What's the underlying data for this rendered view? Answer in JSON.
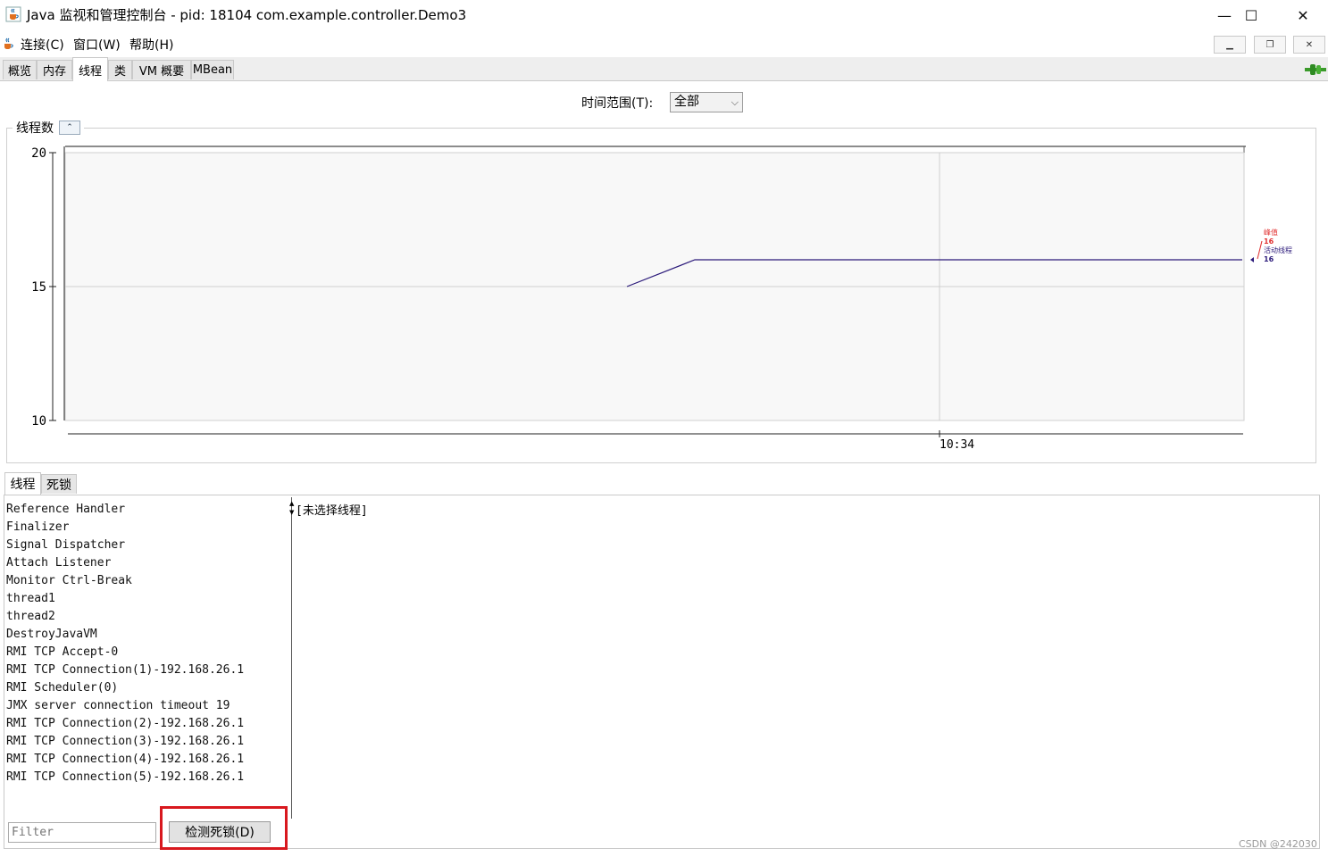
{
  "window": {
    "title": "Java 监视和管理控制台 - pid: 18104 com.example.controller.Demo3",
    "minimize_glyph": "—",
    "maximize_glyph": "☐",
    "close_glyph": "✕"
  },
  "menu": {
    "items": [
      "连接(C)",
      "窗口(W)",
      "帮助(H)"
    ],
    "mdi_minimize": "▁",
    "mdi_restore": "❐",
    "mdi_close": "✕"
  },
  "tabs": [
    {
      "label": "概览",
      "active": false
    },
    {
      "label": "内存",
      "active": false
    },
    {
      "label": "线程",
      "active": true
    },
    {
      "label": "类",
      "active": false
    },
    {
      "label": "VM 概要",
      "active": false
    },
    {
      "label": "MBean",
      "active": false
    }
  ],
  "icons": {
    "connection": "plug-icon",
    "app": "java-cup-icon"
  },
  "time_range": {
    "label": "时间范围(T):",
    "selected": "全部",
    "arrow": "⌵"
  },
  "chart_panel": {
    "title": "线程数",
    "collapse_glyph": "⌃"
  },
  "chart_data": {
    "type": "line",
    "ylim": [
      10,
      20
    ],
    "yticks": [
      "20",
      "15",
      "10"
    ],
    "xticks": [
      "10:34"
    ],
    "series": [
      {
        "name": "峰值",
        "value_label": "16",
        "color": "#e03030",
        "points": []
      },
      {
        "name": "活动线程",
        "value_label": "16",
        "color": "#2b1a7a",
        "points": [
          15,
          16,
          16,
          16,
          16
        ]
      }
    ]
  },
  "lower": {
    "tabs": [
      {
        "label": "线程",
        "active": true
      },
      {
        "label": "死锁",
        "active": false
      }
    ],
    "threads": [
      "Reference Handler",
      "Finalizer",
      "Signal Dispatcher",
      "Attach Listener",
      "Monitor Ctrl-Break",
      "thread1",
      "thread2",
      "DestroyJavaVM",
      "RMI TCP Accept-0",
      "RMI TCP Connection(1)-192.168.26.1",
      "RMI Scheduler(0)",
      "JMX server connection timeout 19",
      "RMI TCP Connection(2)-192.168.26.1",
      "RMI TCP Connection(3)-192.168.26.1",
      "RMI TCP Connection(4)-192.168.26.1",
      "RMI TCP Connection(5)-192.168.26.1"
    ],
    "detail": "[未选择线程]",
    "filter_placeholder": "Filter",
    "deadlock_button": "检测死锁(D)"
  },
  "watermark": "CSDN @242030",
  "colors": {
    "highlight": "#d8181e",
    "line": "#2b1a7a",
    "peak": "#e03030"
  }
}
